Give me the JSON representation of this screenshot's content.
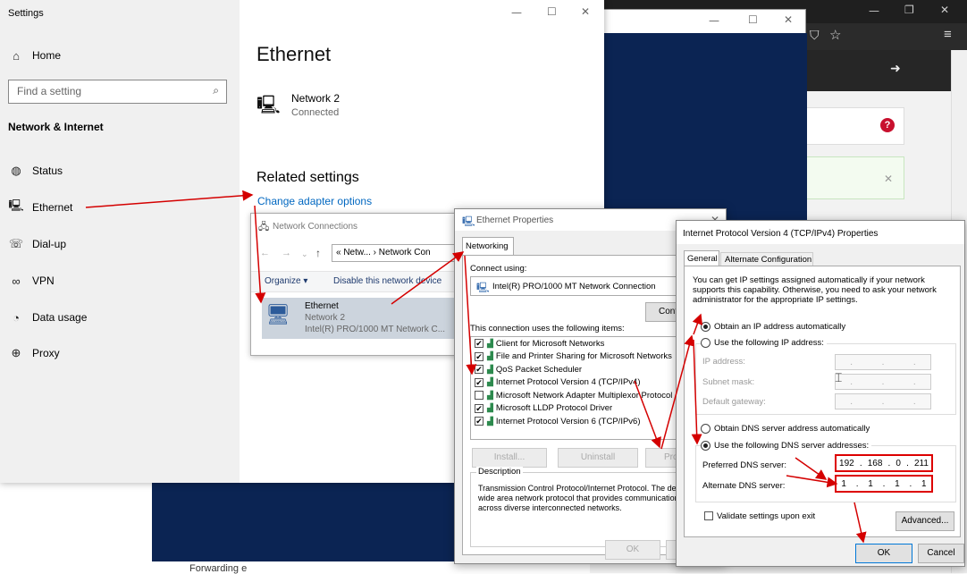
{
  "browser": {
    "close_symbol": "✕",
    "notice_help": "?",
    "notice_close": "✕"
  },
  "settings": {
    "window_title": "Settings",
    "home": "Home",
    "find_placeholder": "Find a setting",
    "section": "Network & Internet",
    "nav": [
      "Status",
      "Ethernet",
      "Dial-up",
      "VPN",
      "Data usage",
      "Proxy"
    ],
    "page_title": "Ethernet",
    "network_name": "Network 2",
    "network_status": "Connected",
    "related_title": "Related settings",
    "change_adapter": "Change adapter options"
  },
  "netconn": {
    "title": "Network Connections",
    "address": "« Netw... › Network Con",
    "organize": "Organize ▾",
    "disable": "Disable this network device",
    "adapter_name": "Ethernet",
    "adapter_network": "Network 2",
    "adapter_device": "Intel(R) PRO/1000 MT Network C..."
  },
  "ethprops": {
    "title": "Ethernet Properties",
    "tab": "Networking",
    "connect_using_label": "Connect using:",
    "adapter": "Intel(R) PRO/1000 MT Network Connection",
    "configure": "Configure...",
    "items_label": "This connection uses the following items:",
    "items": [
      {
        "label": "Client for Microsoft Networks",
        "checked": true
      },
      {
        "label": "File and Printer Sharing for Microsoft Networks",
        "checked": true
      },
      {
        "label": "QoS Packet Scheduler",
        "checked": true
      },
      {
        "label": "Internet Protocol Version 4 (TCP/IPv4)",
        "checked": true
      },
      {
        "label": "Microsoft Network Adapter Multiplexor Protocol",
        "checked": false
      },
      {
        "label": "Microsoft LLDP Protocol Driver",
        "checked": true
      },
      {
        "label": "Internet Protocol Version 6 (TCP/IPv6)",
        "checked": true
      }
    ],
    "install": "Install...",
    "uninstall": "Uninstall",
    "properties": "Properties",
    "description_label": "Description",
    "description": "Transmission Control Protocol/Internet Protocol. The default wide area network protocol that provides communication across diverse interconnected networks.",
    "ok": "OK",
    "cancel": "Cancel"
  },
  "ipv4": {
    "title": "Internet Protocol Version 4 (TCP/IPv4) Properties",
    "tab_general": "General",
    "tab_alt": "Alternate Configuration",
    "intro": "You can get IP settings assigned automatically if your network supports this capability. Otherwise, you need to ask your network administrator for the appropriate IP settings.",
    "obtain_ip": "Obtain an IP address automatically",
    "use_ip": "Use the following IP address:",
    "ip_address": "IP address:",
    "subnet": "Subnet mask:",
    "gateway": "Default gateway:",
    "obtain_dns": "Obtain DNS server address automatically",
    "use_dns": "Use the following DNS server addresses:",
    "preferred_label": "Preferred DNS server:",
    "preferred": [
      "192",
      "168",
      "0",
      "211"
    ],
    "alternate_label": "Alternate DNS server:",
    "alternate": [
      "1",
      "1",
      "1",
      "1"
    ],
    "validate": "Validate settings upon exit",
    "advanced": "Advanced...",
    "ok": "OK",
    "cancel": "Cancel"
  },
  "footer_text": "Forwarding e",
  "colors": {
    "accent": "#0067c0",
    "annotation": "#d40000",
    "navy": "#0b2453"
  }
}
